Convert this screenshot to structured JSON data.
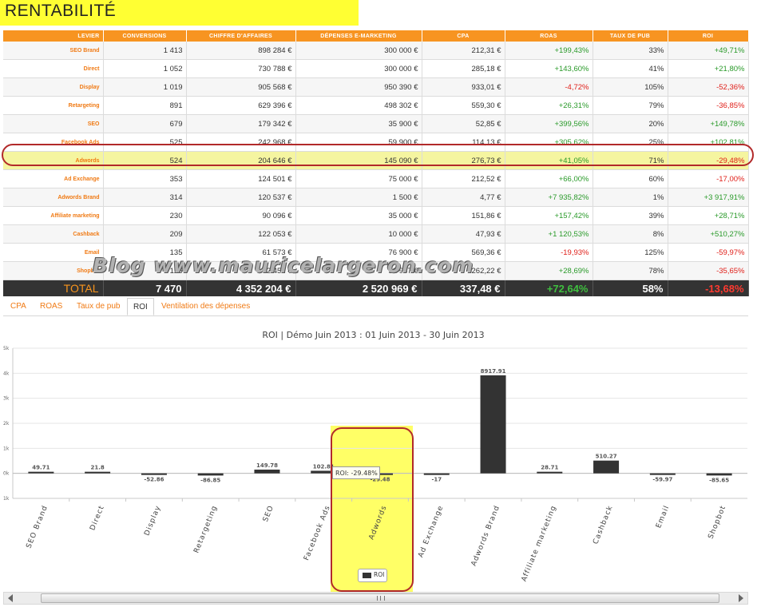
{
  "page_title": "RENTABILITÉ",
  "table": {
    "headers": [
      "LEVIER",
      "CONVERSIONS",
      "CHIFFRE D'AFFAIRES",
      "DÉPENSES E-MARKETING",
      "CPA",
      "ROAS",
      "TAUX DE PUB",
      "ROI"
    ],
    "rows": [
      {
        "levier": "SEO Brand",
        "conversions": "1 413",
        "ca": "898 284 €",
        "depenses": "300 000 €",
        "cpa": "212,31 €",
        "roas": "+199,43%",
        "taux": "33%",
        "roi": "+49,71%"
      },
      {
        "levier": "Direct",
        "conversions": "1 052",
        "ca": "730 788 €",
        "depenses": "300 000 €",
        "cpa": "285,18 €",
        "roas": "+143,60%",
        "taux": "41%",
        "roi": "+21,80%"
      },
      {
        "levier": "Display",
        "conversions": "1 019",
        "ca": "905 568 €",
        "depenses": "950 390 €",
        "cpa": "933,01 €",
        "roas": "-4,72%",
        "taux": "105%",
        "roi": "-52,36%"
      },
      {
        "levier": "Retargeting",
        "conversions": "891",
        "ca": "629 396 €",
        "depenses": "498 302 €",
        "cpa": "559,30 €",
        "roas": "+26,31%",
        "taux": "79%",
        "roi": "-36,85%"
      },
      {
        "levier": "SEO",
        "conversions": "679",
        "ca": "179 342 €",
        "depenses": "35 900 €",
        "cpa": "52,85 €",
        "roas": "+399,56%",
        "taux": "20%",
        "roi": "+149,78%"
      },
      {
        "levier": "Facebook Ads",
        "conversions": "525",
        "ca": "242 968 €",
        "depenses": "59 900 €",
        "cpa": "114,13 €",
        "roas": "+305,62%",
        "taux": "25%",
        "roi": "+102,81%"
      },
      {
        "levier": "Adwords",
        "conversions": "524",
        "ca": "204 646 €",
        "depenses": "145 090 €",
        "cpa": "276,73 €",
        "roas": "+41,05%",
        "taux": "71%",
        "roi": "-29,48%"
      },
      {
        "levier": "Ad Exchange",
        "conversions": "353",
        "ca": "124 501 €",
        "depenses": "75 000 €",
        "cpa": "212,52 €",
        "roas": "+66,00%",
        "taux": "60%",
        "roi": "-17,00%"
      },
      {
        "levier": "Adwords Brand",
        "conversions": "314",
        "ca": "120 537 €",
        "depenses": "1 500 €",
        "cpa": "4,77 €",
        "roas": "+7 935,82%",
        "taux": "1%",
        "roi": "+3 917,91%"
      },
      {
        "levier": "Affiliate marketing",
        "conversions": "230",
        "ca": "90 096 €",
        "depenses": "35 000 €",
        "cpa": "151,86 €",
        "roas": "+157,42%",
        "taux": "39%",
        "roi": "+28,71%"
      },
      {
        "levier": "Cashback",
        "conversions": "209",
        "ca": "122 053 €",
        "depenses": "10 000 €",
        "cpa": "47,93 €",
        "roas": "+1 120,53%",
        "taux": "8%",
        "roi": "+510,27%"
      },
      {
        "levier": "Email",
        "conversions": "135",
        "ca": "61 573 €",
        "depenses": "76 900 €",
        "cpa": "569,36 €",
        "roas": "-19,93%",
        "taux": "125%",
        "roi": "-59,97%"
      },
      {
        "levier": "Shopbot",
        "conversions": "126",
        "ca": "42 452 €",
        "depenses": "32 987 €",
        "cpa": "262,22 €",
        "roas": "+28,69%",
        "taux": "78%",
        "roi": "-35,65%"
      }
    ],
    "total": {
      "label": "TOTAL",
      "conversions": "7 470",
      "ca": "4 352 204 €",
      "depenses": "2 520 969 €",
      "cpa": "337,48 €",
      "roas": "+72,64%",
      "taux": "58%",
      "roi": "-13,68%"
    }
  },
  "watermark": "Blog www.mauricelargeron.com",
  "tabs": [
    "CPA",
    "ROAS",
    "Taux de pub",
    "ROI",
    "Ventilation des dépenses"
  ],
  "active_tab": "ROI",
  "tooltip": "ROI: -29.48%",
  "chart_data": {
    "type": "bar",
    "title": "ROI | Démo Juin 2013 : 01 Juin 2013 - 30 Juin 2013",
    "categories": [
      "SEO Brand",
      "Direct",
      "Display",
      "Retargeting",
      "SEO",
      "Facebook Ads",
      "Adwords",
      "Ad Exchange",
      "Adwords Brand",
      "Affiliate marketing",
      "Cashback",
      "Email",
      "Shopbot"
    ],
    "series": [
      {
        "name": "ROI",
        "values": [
          49.71,
          21.8,
          -52.86,
          -86.85,
          149.78,
          102.81,
          -29.48,
          -17,
          3917.91,
          28.71,
          510.27,
          -59.97,
          -85.65
        ]
      }
    ],
    "ylim": [
      -1000,
      5000
    ],
    "yticks": [
      -1000,
      0,
      1000,
      2000,
      3000,
      4000,
      5000
    ],
    "ytick_labels": [
      "1k",
      "0k",
      "1k",
      "2k",
      "3k",
      "4k",
      "5k"
    ],
    "data_labels": [
      "49.71",
      "21.8",
      "-52.86",
      "-86.85",
      "149.78",
      "102.81",
      "-29.48",
      "-17",
      "8917.91",
      "28.71",
      "510.27",
      "-59.97",
      "-85.65"
    ],
    "highlighted_category": "Adwords",
    "legend": "bottom-center",
    "grid": true,
    "colors": {
      "bar": "#333333",
      "highlight": "#ffff66",
      "accent": "#f7941d"
    }
  }
}
